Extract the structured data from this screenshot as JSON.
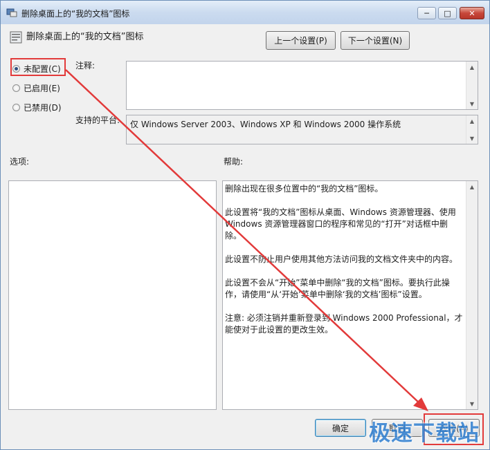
{
  "window": {
    "title": "删除桌面上的“我的文档”图标",
    "controls": {
      "minimize": "─",
      "maximize": "□",
      "close": "✕"
    }
  },
  "header": {
    "title": "删除桌面上的“我的文档”图标",
    "prev_button": "上一个设置(P)",
    "next_button": "下一个设置(N)"
  },
  "state_options": [
    {
      "label": "未配置(C)",
      "selected": true
    },
    {
      "label": "已启用(E)",
      "selected": false
    },
    {
      "label": "已禁用(D)",
      "selected": false
    }
  ],
  "labels": {
    "comment": "注释:",
    "supported_on": "支持的平台:",
    "options": "选项:",
    "help": "帮助:"
  },
  "comment_value": "",
  "supported_on_value": "仅 Windows Server 2003、Windows XP 和 Windows 2000 操作系统",
  "help_paragraphs": [
    "删除出现在很多位置中的“我的文档”图标。",
    "此设置将“我的文档”图标从桌面、Windows 资源管理器、使用 Windows 资源管理器窗口的程序和常见的“打开”对话框中删除。",
    "此设置不防止用户使用其他方法访问我的文档文件夹中的内容。",
    "此设置不会从“开始”菜单中删除“我的文档”图标。要执行此操作，请使用“从‘开始’菜单中删除‘我的文档’图标”设置。",
    "注意: 必须注销并重新登录到 Windows 2000 Professional，才能使对于此设置的更改生效。"
  ],
  "footer": {
    "ok": "确定",
    "cancel": "取消",
    "apply": "应用(A)"
  },
  "watermark": "极速下载站",
  "colors": {
    "highlight": "#e23a3a",
    "watermark": "#2f7fd1"
  }
}
